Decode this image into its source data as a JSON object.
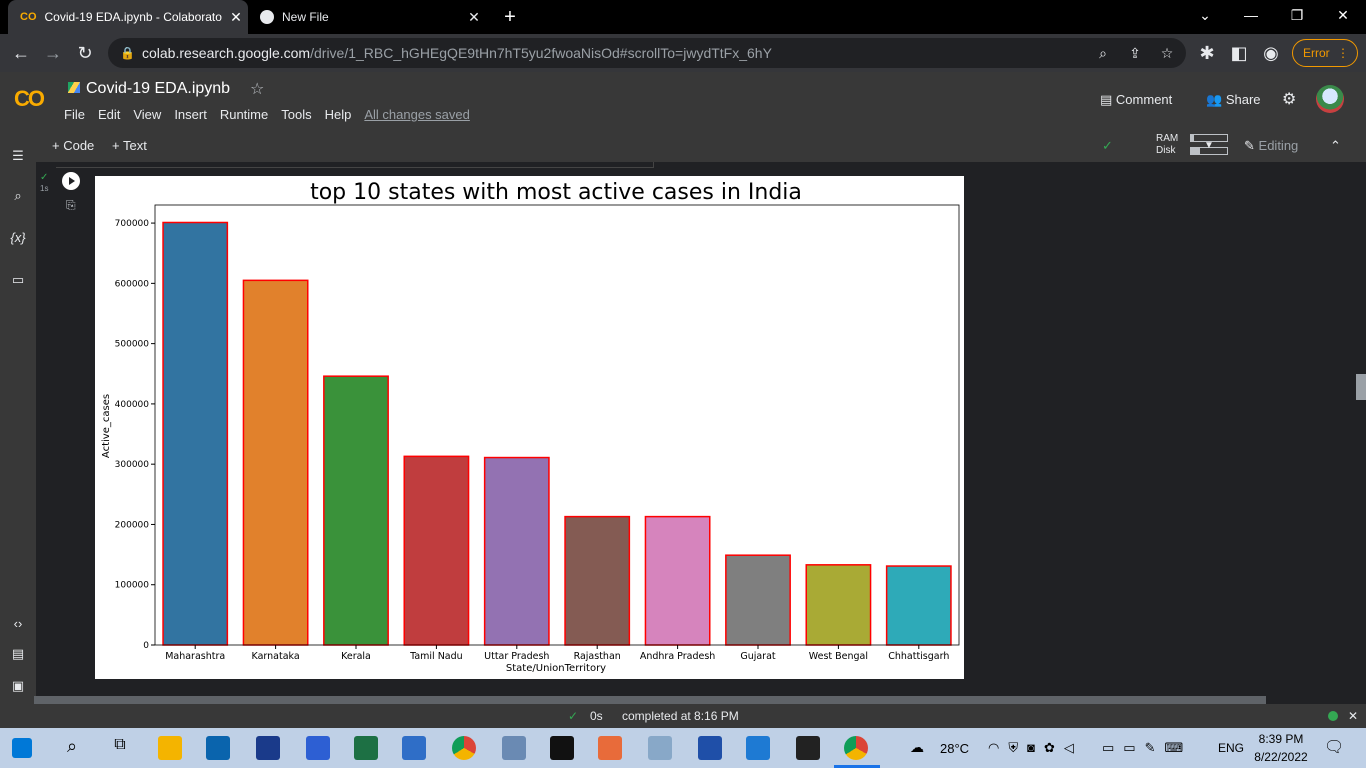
{
  "browser": {
    "tabs": [
      {
        "title": "Covid-19 EDA.ipynb - Colaborato",
        "close": "✕"
      },
      {
        "title": "New File",
        "close": "✕"
      }
    ],
    "new_tab": "+",
    "window": {
      "minimize": "—",
      "restore": "❐",
      "close": "✕",
      "tablist": "⌄"
    },
    "url_host": "colab.research.google.com",
    "url_path": "/drive/1_RBC_hGHEgQE9tHn7hT5yu2fwoaNisOd#scrollTo=jwydTtFx_6hY",
    "error_label": "Error"
  },
  "colab": {
    "logo": "CO",
    "notebook_title": "Covid-19 EDA.ipynb",
    "menu": [
      "File",
      "Edit",
      "View",
      "Insert",
      "Runtime",
      "Tools",
      "Help"
    ],
    "save_status": "All changes saved",
    "comment_label": "Comment",
    "share_label": "Share",
    "add_code": "+ Code",
    "add_text": "+ Text",
    "ram_label": "RAM",
    "disk_label": "Disk",
    "ram_usage": 0.08,
    "disk_usage": 0.25,
    "editing_label": "Editing",
    "exec_time": "1s",
    "status_time": "0s",
    "status_text": "completed at 8:16 PM"
  },
  "chart_data": {
    "type": "bar",
    "title": "top 10 states with most active cases in India",
    "xlabel": "State/UnionTerritory",
    "ylabel": "Active_cases",
    "ylim": [
      0,
      730000
    ],
    "yticks": [
      0,
      100000,
      200000,
      300000,
      400000,
      500000,
      600000,
      700000
    ],
    "categories": [
      "Maharashtra",
      "Karnataka",
      "Kerala",
      "Tamil Nadu",
      "Uttar Pradesh",
      "Rajasthan",
      "Andhra Pradesh",
      "Gujarat",
      "West Bengal",
      "Chhattisgarh"
    ],
    "values": [
      701000,
      605000,
      446000,
      313000,
      311000,
      213000,
      213000,
      149000,
      133000,
      131000
    ],
    "colors": [
      "#3274a1",
      "#e1812c",
      "#3a923a",
      "#c03d3e",
      "#9372b2",
      "#845b53",
      "#d684bd",
      "#7f7f7f",
      "#a9aa35",
      "#2eaab8"
    ],
    "edge_color": "#ff0000",
    "grid": false
  },
  "taskbar": {
    "weather": "28°C",
    "lang": "ENG",
    "time": "8:39 PM",
    "date": "8/22/2022"
  }
}
